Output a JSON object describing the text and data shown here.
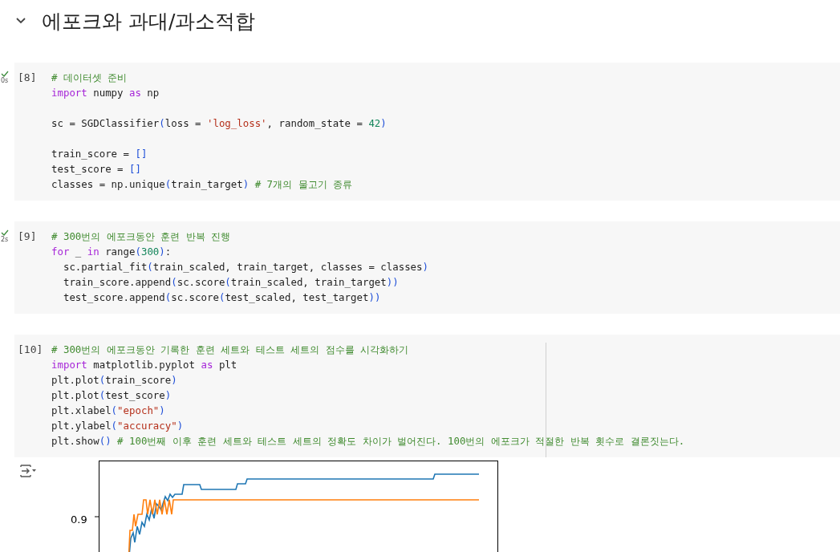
{
  "section": {
    "title": "에포크와 과대/과소적합",
    "expanded": true
  },
  "cells": [
    {
      "prompt": "[8]",
      "status": {
        "done": true,
        "time": "0s"
      },
      "blocks": [
        [
          [
            {
              "kind": "comment",
              "t": "# 데이터셋 준비"
            }
          ],
          [
            {
              "kind": "keyword",
              "t": "import"
            },
            {
              "kind": "plain",
              "t": " numpy "
            },
            {
              "kind": "keyword",
              "t": "as"
            },
            {
              "kind": "plain",
              "t": " np"
            }
          ]
        ],
        [
          [
            {
              "kind": "plain",
              "t": "sc = SGDClassifier"
            },
            {
              "kind": "bracket",
              "t": "("
            },
            {
              "kind": "plain",
              "t": "loss = "
            },
            {
              "kind": "string",
              "t": "'log_loss'"
            },
            {
              "kind": "plain",
              "t": ", random_state = "
            },
            {
              "kind": "number",
              "t": "42"
            },
            {
              "kind": "bracket",
              "t": ")"
            }
          ]
        ],
        [
          [
            {
              "kind": "plain",
              "t": "train_score = "
            },
            {
              "kind": "bracket",
              "t": "[]"
            }
          ],
          [
            {
              "kind": "plain",
              "t": "test_score = "
            },
            {
              "kind": "bracket",
              "t": "[]"
            }
          ],
          [
            {
              "kind": "plain",
              "t": "classes = np.unique"
            },
            {
              "kind": "bracket",
              "t": "("
            },
            {
              "kind": "plain",
              "t": "train_target"
            },
            {
              "kind": "bracket",
              "t": ")"
            },
            {
              "kind": "comment",
              "t": " # 7개의 물고기 종류"
            }
          ]
        ]
      ]
    },
    {
      "prompt": "[9]",
      "status": {
        "done": true,
        "time": "2s"
      },
      "blocks": [
        [
          [
            {
              "kind": "comment",
              "t": "# 300번의 에포크동안 훈련 반복 진행"
            }
          ],
          [
            {
              "kind": "keyword",
              "t": "for"
            },
            {
              "kind": "plain",
              "t": " _ "
            },
            {
              "kind": "keyword",
              "t": "in"
            },
            {
              "kind": "plain",
              "t": " range"
            },
            {
              "kind": "bracket",
              "t": "("
            },
            {
              "kind": "number",
              "t": "300"
            },
            {
              "kind": "bracket",
              "t": ")"
            },
            {
              "kind": "plain",
              "t": ":"
            }
          ],
          [
            {
              "kind": "plain",
              "t": "  sc.partial_fit"
            },
            {
              "kind": "bracket",
              "t": "("
            },
            {
              "kind": "plain",
              "t": "train_scaled, train_target, classes = classes"
            },
            {
              "kind": "bracket",
              "t": ")"
            }
          ],
          [
            {
              "kind": "plain",
              "t": "  train_score.append"
            },
            {
              "kind": "bracket",
              "t": "("
            },
            {
              "kind": "plain",
              "t": "sc.score"
            },
            {
              "kind": "bracket",
              "t": "("
            },
            {
              "kind": "plain",
              "t": "train_scaled, train_target"
            },
            {
              "kind": "bracket",
              "t": "))"
            }
          ],
          [
            {
              "kind": "plain",
              "t": "  test_score.append"
            },
            {
              "kind": "bracket",
              "t": "("
            },
            {
              "kind": "plain",
              "t": "sc.score"
            },
            {
              "kind": "bracket",
              "t": "("
            },
            {
              "kind": "plain",
              "t": "test_scaled, test_target"
            },
            {
              "kind": "bracket",
              "t": "))"
            }
          ]
        ]
      ]
    },
    {
      "prompt": "[10]",
      "blocks": [
        [
          [
            {
              "kind": "comment",
              "t": "# 300번의 에포크동안 기록한 훈련 세트와 테스트 세트의 점수를 시각화하기"
            }
          ],
          [
            {
              "kind": "keyword",
              "t": "import"
            },
            {
              "kind": "plain",
              "t": " matplotlib.pyplot "
            },
            {
              "kind": "keyword",
              "t": "as"
            },
            {
              "kind": "plain",
              "t": " plt"
            }
          ],
          [
            {
              "kind": "plain",
              "t": "plt.plot"
            },
            {
              "kind": "bracket",
              "t": "("
            },
            {
              "kind": "plain",
              "t": "train_score"
            },
            {
              "kind": "bracket",
              "t": ")"
            }
          ],
          [
            {
              "kind": "plain",
              "t": "plt.plot"
            },
            {
              "kind": "bracket",
              "t": "("
            },
            {
              "kind": "plain",
              "t": "test_score"
            },
            {
              "kind": "bracket",
              "t": ")"
            }
          ],
          [
            {
              "kind": "plain",
              "t": "plt.xlabel"
            },
            {
              "kind": "bracket",
              "t": "("
            },
            {
              "kind": "string",
              "t": "\"epoch\""
            },
            {
              "kind": "bracket",
              "t": ")"
            }
          ],
          [
            {
              "kind": "plain",
              "t": "plt.ylabel"
            },
            {
              "kind": "bracket",
              "t": "("
            },
            {
              "kind": "string",
              "t": "\"accuracy\""
            },
            {
              "kind": "bracket",
              "t": ")"
            }
          ],
          [
            {
              "kind": "plain",
              "t": "plt.show"
            },
            {
              "kind": "bracket",
              "t": "()"
            },
            {
              "kind": "comment",
              "t": " # 100번째 이후 훈련 세트와 테스트 세트의 정확도 차이가 벌어진다. 100번의 에포크가 적절한 반복 횟수로 결론짓는다."
            }
          ]
        ]
      ],
      "output": {
        "tick_label": "0.9"
      }
    }
  ]
}
